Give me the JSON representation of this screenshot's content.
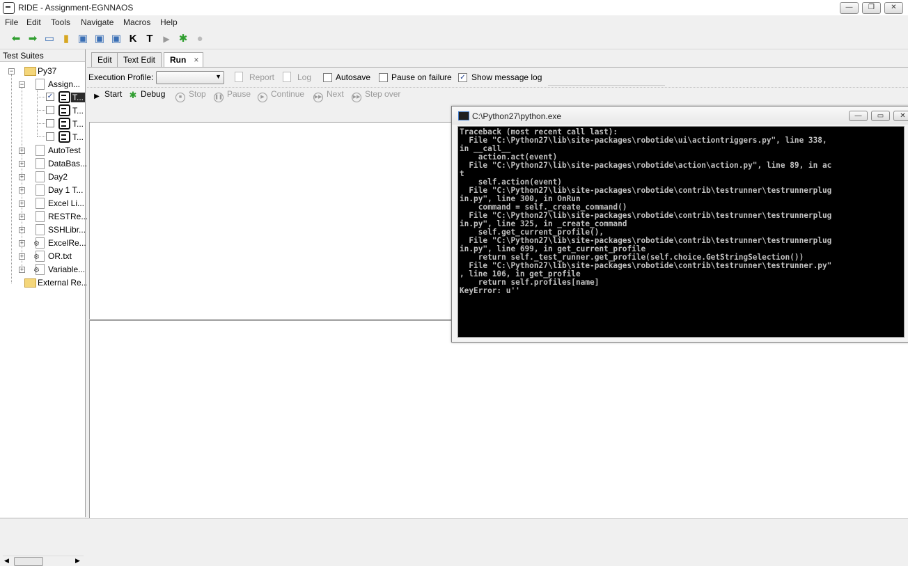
{
  "window": {
    "title": "RIDE - Assignment-EGNNAOS"
  },
  "menu": [
    "File",
    "Edit",
    "Tools",
    "Navigate",
    "Macros",
    "Help"
  ],
  "toolbar_icons": [
    "back-arrow-icon",
    "forward-arrow-icon",
    "open-folder-icon",
    "open-directory-icon",
    "save-icon",
    "save-all-icon",
    "reload-icon",
    "keyword-search-icon",
    "text-search-icon",
    "run-icon",
    "debug-bug-icon",
    "stop-icon"
  ],
  "tree": {
    "header": "Test Suites",
    "root": "Py37",
    "assign": "Assign...",
    "tests": [
      "T...",
      "T...",
      "T...",
      "T..."
    ],
    "suites": [
      "AutoTest",
      "DataBas...",
      "Day2",
      "Day 1 T...",
      "Excel Li...",
      "RESTRe...",
      "SSHLibr...",
      "ExcelRe...",
      "OR.txt",
      "Variable..."
    ],
    "external": "External Re..."
  },
  "tabs": {
    "edit": "Edit",
    "text_edit": "Text Edit",
    "run": "Run",
    "close": "×"
  },
  "run": {
    "execution_profile_label": "Execution Profile:",
    "report": "Report",
    "log": "Log",
    "autosave": "Autosave",
    "pause_on_failure": "Pause on failure",
    "show_message_log": "Show message log",
    "start": "Start",
    "debug": "Debug",
    "stop": "Stop",
    "pause": "Pause",
    "continue": "Continue",
    "next": "Next",
    "step_over": "Step over"
  },
  "console": {
    "title": "C:\\Python27\\python.exe",
    "text": "Traceback (most recent call last):\n  File \"C:\\Python27\\lib\\site-packages\\robotide\\ui\\actiontriggers.py\", line 338,\nin __call__\n    action.act(event)\n  File \"C:\\Python27\\lib\\site-packages\\robotide\\action\\action.py\", line 89, in ac\nt\n    self.action(event)\n  File \"C:\\Python27\\lib\\site-packages\\robotide\\contrib\\testrunner\\testrunnerplug\nin.py\", line 300, in OnRun\n    command = self._create_command()\n  File \"C:\\Python27\\lib\\site-packages\\robotide\\contrib\\testrunner\\testrunnerplug\nin.py\", line 325, in _create_command\n    self.get_current_profile(),\n  File \"C:\\Python27\\lib\\site-packages\\robotide\\contrib\\testrunner\\testrunnerplug\nin.py\", line 699, in get_current_profile\n    return self._test_runner.get_profile(self.choice.GetStringSelection())\n  File \"C:\\Python27\\lib\\site-packages\\robotide\\contrib\\testrunner\\testrunner.py\"\n, line 106, in get_profile\n    return self.profiles[name]\nKeyError: u''"
  },
  "colors": {
    "accent_green": "#2f9e2f",
    "console_bg": "#000000",
    "console_fg": "#c0c0c0"
  }
}
